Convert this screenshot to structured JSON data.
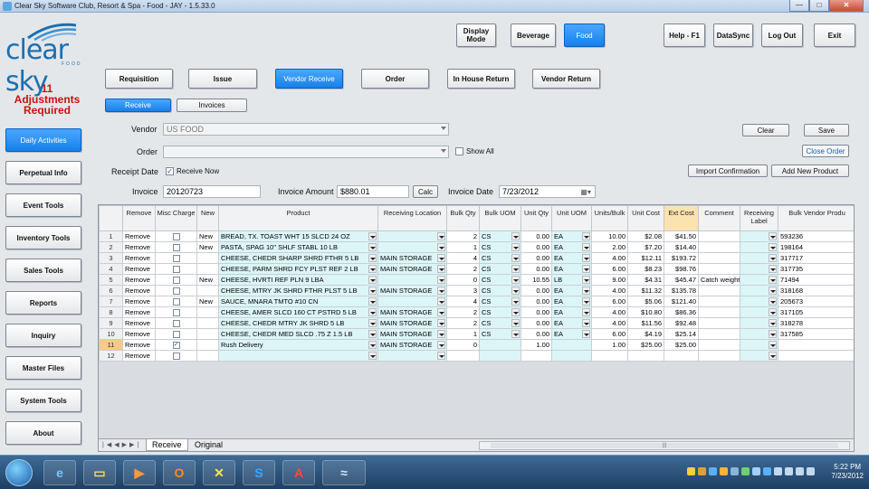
{
  "window": {
    "title": "Clear Sky Software Club, Resort & Spa - Food - JAY - 1.5.33.0"
  },
  "logo": {
    "word": "clear sky",
    "sub": "FOOD"
  },
  "alert": {
    "count": "11",
    "text": "Adjustments Required"
  },
  "top_buttons": {
    "display_mode": "Display Mode",
    "beverage": "Beverage",
    "food": "Food",
    "help": "Help - F1",
    "datasync": "DataSync",
    "logout": "Log Out",
    "exit": "Exit"
  },
  "sidebar": [
    "Daily Activities",
    "Perpetual Info",
    "Event Tools",
    "Inventory Tools",
    "Sales Tools",
    "Reports",
    "Inquiry",
    "Master Files",
    "System Tools",
    "About"
  ],
  "activity_tabs": [
    "Requisition",
    "Issue",
    "Vendor Receive",
    "Order",
    "In House Return",
    "Vendor Return"
  ],
  "sub_tabs": [
    "Receive",
    "Invoices"
  ],
  "form": {
    "vendor_label": "Vendor",
    "vendor_value": "US FOOD",
    "order_label": "Order",
    "order_value": "",
    "show_all": "Show All",
    "receipt_date_label": "Receipt Date",
    "receive_now": "Receive Now",
    "invoice_label": "Invoice",
    "invoice_value": "20120723",
    "invoice_amount_label": "Invoice Amount",
    "invoice_amount_value": "$880.01",
    "calc": "Calc",
    "invoice_date_label": "Invoice Date",
    "invoice_date_value": "7/23/2012"
  },
  "right_buttons": {
    "clear": "Clear",
    "save": "Save",
    "close_order": "Close Order",
    "import_confirmation": "Import Confirmation",
    "add_new_product": "Add New Product"
  },
  "grid": {
    "headers": [
      "",
      "Remove",
      "Misc Charge",
      "New",
      "Product",
      "Receiving Location",
      "Bulk Qty",
      "Bulk UOM",
      "Unit Qty",
      "Unit UOM",
      "Units/Bulk",
      "Unit Cost",
      "Ext Cost",
      "Comment",
      "Receiving Label",
      "Bulk Vendor Produ"
    ],
    "rows": [
      {
        "n": "1",
        "remove": "Remove",
        "misc": false,
        "new": "New",
        "product": "BREAD, TX. TOAST WHT 15 SLCD 24 OZ",
        "loc": "",
        "bulk_qty": "2",
        "bulk_uom": "CS",
        "unit_qty": "0.00",
        "unit_uom": "EA",
        "units_bulk": "10.00",
        "unit_cost": "$2.08",
        "ext_cost": "$41.50",
        "comment": "",
        "vendor_prod": "593236"
      },
      {
        "n": "2",
        "remove": "Remove",
        "misc": false,
        "new": "New",
        "product": "PASTA, SPAG 10\" SHLF STABL 10 LB",
        "loc": "",
        "bulk_qty": "1",
        "bulk_uom": "CS",
        "unit_qty": "0.00",
        "unit_uom": "EA",
        "units_bulk": "2.00",
        "unit_cost": "$7.20",
        "ext_cost": "$14.40",
        "comment": "",
        "vendor_prod": "198164"
      },
      {
        "n": "3",
        "remove": "Remove",
        "misc": false,
        "new": "",
        "product": "CHEESE, CHEDR SHARP SHRD FTHR 5 LB",
        "loc": "MAIN STORAGE",
        "bulk_qty": "4",
        "bulk_uom": "CS",
        "unit_qty": "0.00",
        "unit_uom": "EA",
        "units_bulk": "4.00",
        "unit_cost": "$12.11",
        "ext_cost": "$193.72",
        "comment": "",
        "vendor_prod": "317717"
      },
      {
        "n": "4",
        "remove": "Remove",
        "misc": false,
        "new": "",
        "product": "CHEESE, PARM SHRD FCY PLST REF 2 LB",
        "loc": "MAIN STORAGE",
        "bulk_qty": "2",
        "bulk_uom": "CS",
        "unit_qty": "0.00",
        "unit_uom": "EA",
        "units_bulk": "6.00",
        "unit_cost": "$8.23",
        "ext_cost": "$98.76",
        "comment": "",
        "vendor_prod": "317735"
      },
      {
        "n": "5",
        "remove": "Remove",
        "misc": false,
        "new": "New",
        "product": "CHEESE, HVRTI REF PLN 9 LBA",
        "loc": "",
        "bulk_qty": "0",
        "bulk_uom": "CS",
        "unit_qty": "10.55",
        "unit_uom": "LB",
        "units_bulk": "9.00",
        "unit_cost": "$4.31",
        "ext_cost": "$45.47",
        "comment": "Catch weight",
        "vendor_prod": "71494"
      },
      {
        "n": "6",
        "remove": "Remove",
        "misc": false,
        "new": "",
        "product": "CHEESE, MTRY JK SHRD FTHR PLST 5 LB",
        "loc": "MAIN STORAGE",
        "bulk_qty": "3",
        "bulk_uom": "CS",
        "unit_qty": "0.00",
        "unit_uom": "EA",
        "units_bulk": "4.00",
        "unit_cost": "$11.32",
        "ext_cost": "$135.78",
        "comment": "",
        "vendor_prod": "318168"
      },
      {
        "n": "7",
        "remove": "Remove",
        "misc": false,
        "new": "New",
        "product": "SAUCE, MNARA TMTO #10 CN",
        "loc": "",
        "bulk_qty": "4",
        "bulk_uom": "CS",
        "unit_qty": "0.00",
        "unit_uom": "EA",
        "units_bulk": "6.00",
        "unit_cost": "$5.06",
        "ext_cost": "$121.40",
        "comment": "",
        "vendor_prod": "205673"
      },
      {
        "n": "8",
        "remove": "Remove",
        "misc": false,
        "new": "",
        "product": "CHEESE, AMER SLCD 160 CT PSTRD 5 LB",
        "loc": "MAIN STORAGE",
        "bulk_qty": "2",
        "bulk_uom": "CS",
        "unit_qty": "0.00",
        "unit_uom": "EA",
        "units_bulk": "4.00",
        "unit_cost": "$10.80",
        "ext_cost": "$86.36",
        "comment": "",
        "vendor_prod": "317105"
      },
      {
        "n": "9",
        "remove": "Remove",
        "misc": false,
        "new": "",
        "product": "CHEESE, CHEDR MTRY JK SHRD 5 LB",
        "loc": "MAIN STORAGE",
        "bulk_qty": "2",
        "bulk_uom": "CS",
        "unit_qty": "0.00",
        "unit_uom": "EA",
        "units_bulk": "4.00",
        "unit_cost": "$11.56",
        "ext_cost": "$92.48",
        "comment": "",
        "vendor_prod": "318278"
      },
      {
        "n": "10",
        "remove": "Remove",
        "misc": false,
        "new": "",
        "product": "CHEESE, CHEDR MED SLCD .75 Z 1.5 LB",
        "loc": "MAIN STORAGE",
        "bulk_qty": "1",
        "bulk_uom": "CS",
        "unit_qty": "0.00",
        "unit_uom": "EA",
        "units_bulk": "6.00",
        "unit_cost": "$4.19",
        "ext_cost": "$25.14",
        "comment": "",
        "vendor_prod": "317585"
      },
      {
        "n": "11",
        "remove": "Remove",
        "misc": true,
        "new": "",
        "product": "Rush Delivery",
        "loc": "MAIN STORAGE",
        "bulk_qty": "0",
        "bulk_uom": "",
        "unit_qty": "1.00",
        "unit_uom": "",
        "units_bulk": "1.00",
        "unit_cost": "$25.00",
        "ext_cost": "$25.00",
        "comment": "",
        "vendor_prod": ""
      },
      {
        "n": "12",
        "remove": "Remove",
        "misc": false,
        "new": "",
        "product": "",
        "loc": "",
        "bulk_qty": "",
        "bulk_uom": "",
        "unit_qty": "",
        "unit_uom": "",
        "units_bulk": "",
        "unit_cost": "",
        "ext_cost": "",
        "comment": "",
        "vendor_prod": ""
      }
    ],
    "sheet_tabs": [
      "Receive",
      "Original"
    ]
  },
  "taskbar": {
    "time": "5:22 PM",
    "date": "7/23/2012"
  },
  "colors": {
    "accent_blue": "#1780ea",
    "alert_red": "#cc1010",
    "highlight_orange": "#fbe3b0"
  }
}
